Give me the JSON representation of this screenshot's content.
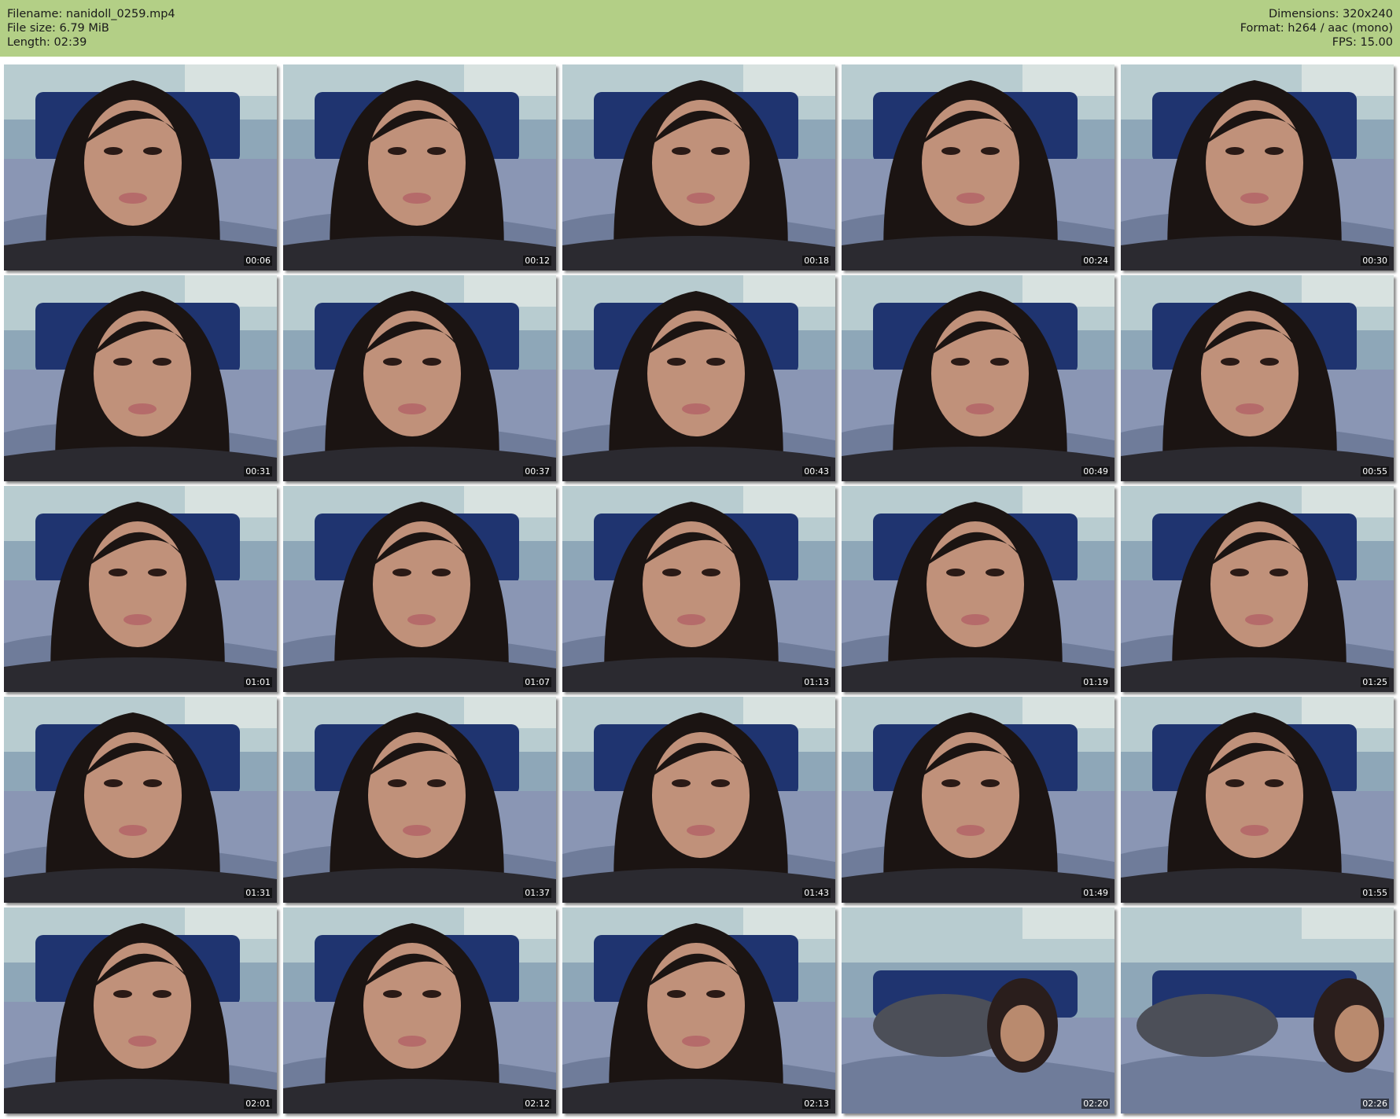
{
  "header": {
    "filename": "Filename: nanidoll_0259.mp4",
    "file_size": "File size: 6.79 MiB",
    "length": "Length: 02:39",
    "dimensions": "Dimensions: 320x240",
    "format": "Format: h264 / aac (mono)",
    "fps": "FPS: 15.00"
  },
  "colors": {
    "header_bg": "#b3cf86",
    "page_bg": "#ffffff"
  },
  "grid": {
    "columns": 5,
    "rows": 5,
    "timestamps": [
      "00:06",
      "00:12",
      "00:18",
      "00:24",
      "00:30",
      "00:31",
      "00:37",
      "00:43",
      "00:49",
      "00:55",
      "01:01",
      "01:07",
      "01:13",
      "01:19",
      "01:25",
      "01:31",
      "01:37",
      "01:43",
      "01:49",
      "01:55",
      "02:01",
      "02:12",
      "02:13",
      "02:20",
      "02:26"
    ]
  }
}
